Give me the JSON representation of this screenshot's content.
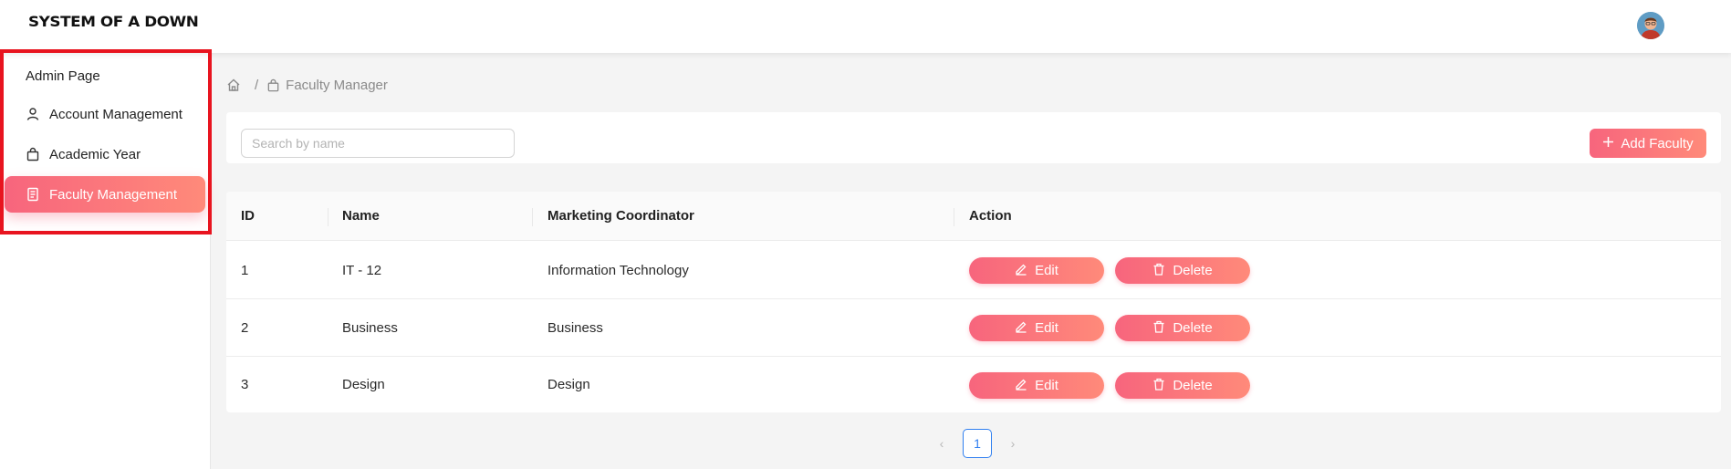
{
  "header": {
    "logo_text": "SYSTEM OF A DOWN"
  },
  "sidebar": {
    "title": "Admin Page",
    "items": [
      {
        "label": "Account Management",
        "icon": "user-icon",
        "active": false
      },
      {
        "label": "Academic Year",
        "icon": "bag-icon",
        "active": false
      },
      {
        "label": "Faculty Management",
        "icon": "document-icon",
        "active": true
      }
    ]
  },
  "breadcrumb": {
    "separator": "/",
    "current": "Faculty Manager"
  },
  "toolbar": {
    "search_placeholder": "Search by name",
    "search_value": "",
    "add_label": "Add Faculty"
  },
  "table": {
    "columns": [
      "ID",
      "Name",
      "Marketing Coordinator",
      "Action"
    ],
    "rows": [
      {
        "id": "1",
        "name": "IT - 12",
        "coordinator": "Information Technology"
      },
      {
        "id": "2",
        "name": "Business",
        "coordinator": "Business"
      },
      {
        "id": "3",
        "name": "Design",
        "coordinator": "Design"
      }
    ],
    "edit_label": "Edit",
    "delete_label": "Delete"
  },
  "pagination": {
    "current_page": "1",
    "prev_symbol": "‹",
    "next_symbol": "›"
  },
  "colors": {
    "accent_start": "#f7657d",
    "accent_end": "#ff8a7a",
    "highlight_border": "#e8141f",
    "page_active": "#2f7ff0"
  }
}
